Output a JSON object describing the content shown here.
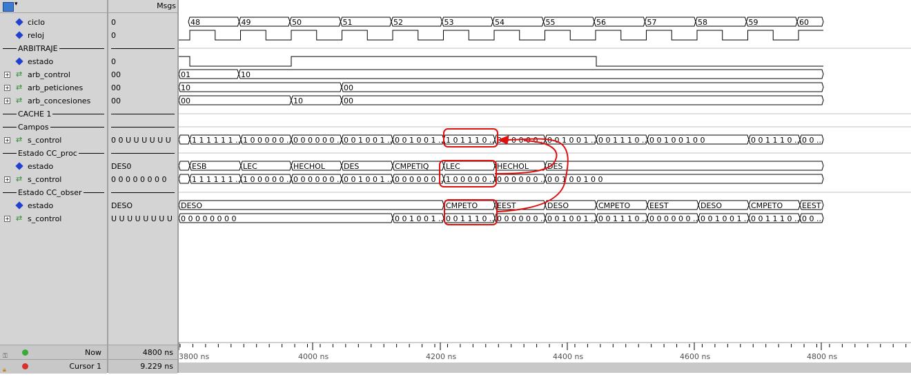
{
  "header": {
    "msgs_label": "Msgs"
  },
  "signals": [
    {
      "kind": "signal",
      "name": "ciclo",
      "value": "0",
      "expand": false
    },
    {
      "kind": "signal",
      "name": "reloj",
      "value": "0",
      "expand": false
    },
    {
      "kind": "group",
      "name": "ARBITRAJE"
    },
    {
      "kind": "signal",
      "name": "estado",
      "value": "0",
      "expand": false
    },
    {
      "kind": "bus",
      "name": "arb_control",
      "value": "00",
      "expand": true
    },
    {
      "kind": "bus",
      "name": "arb_peticiones",
      "value": "00",
      "expand": true
    },
    {
      "kind": "bus",
      "name": "arb_concesiones",
      "value": "00",
      "expand": true
    },
    {
      "kind": "group",
      "name": "CACHE 1"
    },
    {
      "kind": "group",
      "name": "Campos"
    },
    {
      "kind": "bus",
      "name": "s_control",
      "value": "0 0 U U U U U U",
      "expand": true
    },
    {
      "kind": "group",
      "name": "Estado CC_proc"
    },
    {
      "kind": "signal",
      "name": "estado",
      "value": "DES0",
      "expand": false
    },
    {
      "kind": "bus",
      "name": "s_control",
      "value": "0 0 0 0 0 0 0 0",
      "expand": true
    },
    {
      "kind": "group",
      "name": "Estado CC_obser"
    },
    {
      "kind": "signal",
      "name": "estado",
      "value": "DESO",
      "expand": false
    },
    {
      "kind": "bus",
      "name": "s_control",
      "value": "U U U U U U U U",
      "expand": true
    }
  ],
  "footer": {
    "now_label": "Now",
    "now_value": "4800 ns",
    "cursor_label": "Cursor 1",
    "cursor_value": "9.229 ns"
  },
  "timeline": {
    "ticks": [
      "3800 ns",
      "4000 ns",
      "4200 ns",
      "4400 ns",
      "4600 ns",
      "4800 ns"
    ]
  },
  "waves": {
    "ciclo": [
      "48",
      "49",
      "50",
      "51",
      "52",
      "53",
      "54",
      "55",
      "56",
      "57",
      "58",
      "59",
      "60"
    ],
    "arb_control": [
      "01",
      "10"
    ],
    "arb_peticiones": [
      "10",
      "00"
    ],
    "arb_concesiones": [
      "00",
      "10",
      "00"
    ],
    "campos_s_control": [
      "1 1 1 1 1 1 ...",
      "1 0 0 0 0 0 ...",
      "0 0 0 0 0 0 ...",
      "0 0 1 0 0 1 ...",
      "0 0 1 0 0 1 ...",
      "1 0 1 1 1 0 ...",
      "0 0 0 0 0 0 ...",
      "0 0 1 0 0 1 ...",
      "0 0 1 1 1 0 ...",
      "0 0 1 0 0 1 0 0",
      "0 0 1 1 1 0 ...",
      "0 0 ..."
    ],
    "proc_estado": [
      "ESB",
      "LEC",
      "HECHOL",
      "DES",
      "CMPETIQ",
      "LEC",
      "HECHOL",
      "DES"
    ],
    "proc_s_control": [
      "1 1 1 1 1 1 ...",
      "1 0 0 0 0 0 ...",
      "0 0 0 0 0 0 ...",
      "0 0 1 0 0 1 ...",
      "0 0 0 0 0 0 ...",
      "1 0 0 0 0 0 ...",
      "0 0 0 0 0 0 ...",
      "0 0 1 0 0 1 0 0"
    ],
    "obser_estado": [
      "DESO",
      "CMPETO",
      "EEST",
      "DESO",
      "CMPETO",
      "EEST",
      "DESO",
      "CMPETO",
      "EEST"
    ],
    "obser_s_control": [
      "0 0 0 0 0 0 0 0",
      "0 0 1 0 0 1 ...",
      "0 0 1 1 1 0 ...",
      "0 0 0 0 0 0 ...",
      "0 0 1 0 0 1 ...",
      "0 0 1 1 1 0 ...",
      "0 0 0 0 0 0 ...",
      "0 0 1 0 0 1 ...",
      "0 0 1 1 1 0 ...",
      "0 0 ..."
    ]
  },
  "colors": {
    "pane": "#d4d4d4",
    "signal_icon": "#2040d0",
    "annotation": "#e01010"
  }
}
